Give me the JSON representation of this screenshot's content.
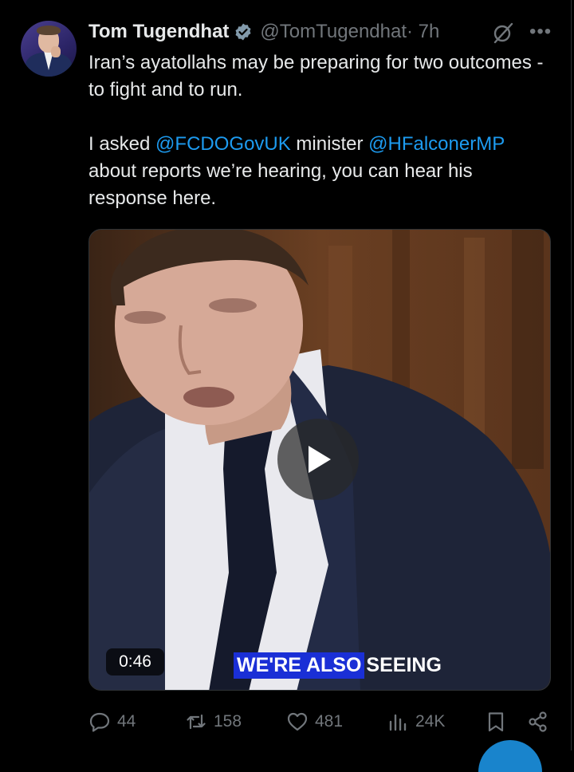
{
  "tweet": {
    "author_name": "Tom Tugendhat",
    "handle": "@TomTugendhat",
    "time": " · 7h",
    "text_line1": "Iran’s ayatollahs may be preparing for two outcomes - to fight and to run.",
    "text_p2_a": "I asked ",
    "mention1": "@FCDOGovUK",
    "text_p2_b": " minister ",
    "mention2": "@HFalconerMP",
    "text_p2_c": " about reports we’re hearing, you can hear his response here."
  },
  "video": {
    "duration": "0:46",
    "caption_highlight": "WE'RE ALSO",
    "caption_rest": " SEEING"
  },
  "actions": {
    "replies": "44",
    "reposts": "158",
    "likes": "481",
    "views": "24K"
  },
  "icons": {
    "verified": "verified-badge-icon",
    "grok": "grok-icon",
    "more": "more-dots-icon",
    "play": "play-icon",
    "reply": "reply-icon",
    "repost": "repost-icon",
    "like": "heart-icon",
    "views": "views-icon",
    "bookmark": "bookmark-icon",
    "share": "share-icon"
  },
  "colors": {
    "accent": "#1d9bf0",
    "muted": "#71767b",
    "text": "#e7e9ea",
    "background": "#000000"
  }
}
